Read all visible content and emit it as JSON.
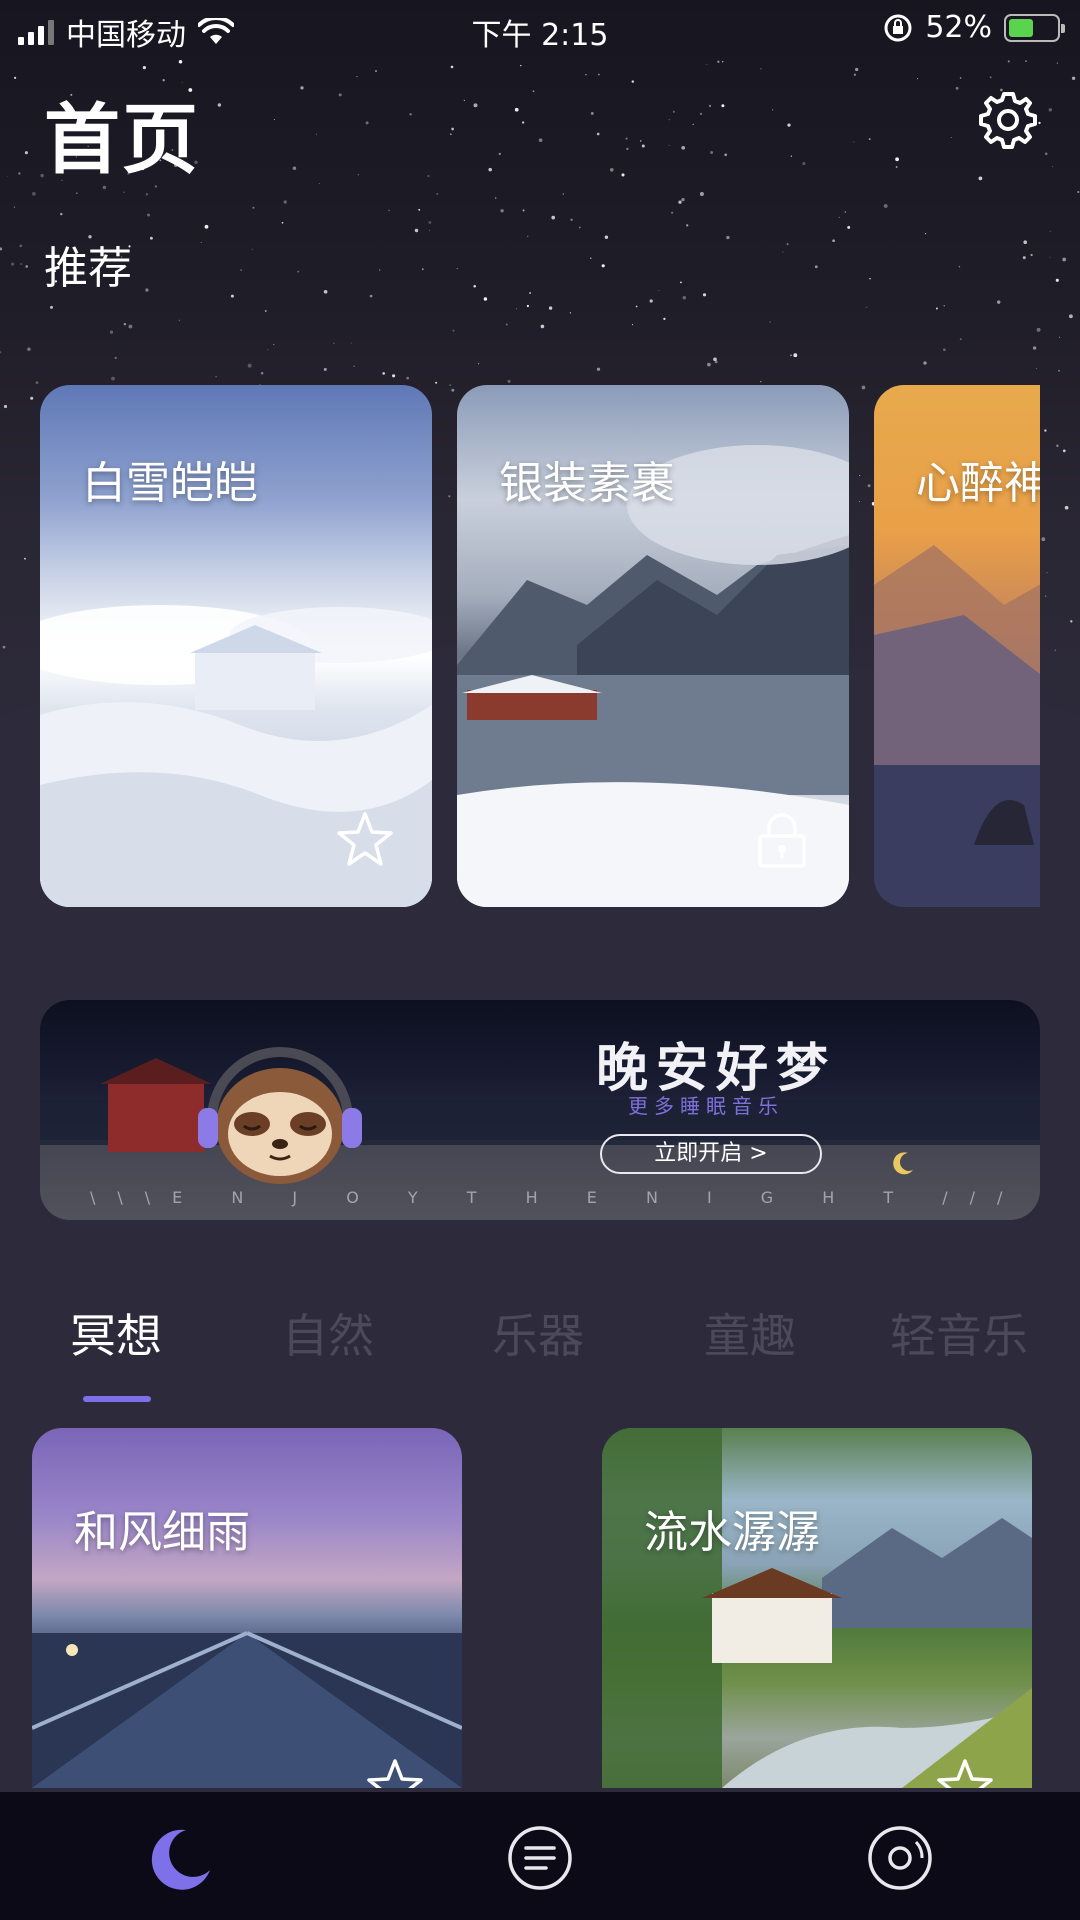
{
  "status_bar": {
    "carrier": "中国移动",
    "time": "下午 2:15",
    "battery_percent": "52%"
  },
  "header": {
    "title": "首页"
  },
  "recommend": {
    "section_title": "推荐",
    "cards": [
      {
        "label": "白雪皑皑",
        "icon": "star-outline-icon"
      },
      {
        "label": "银装素裹",
        "icon": "lock-icon"
      },
      {
        "label": "心醉神"
      }
    ]
  },
  "banner": {
    "title": "晚安好梦",
    "subtitle": "更多睡眠音乐",
    "button_label": "立即开启 >",
    "footer": "\\\\\\E N J O Y   T H E   N I G H T ///"
  },
  "categories": {
    "tabs": [
      "冥想",
      "自然",
      "乐器",
      "童趣",
      "轻音乐"
    ],
    "active_index": 0
  },
  "sounds": [
    {
      "label": "和风细雨",
      "icon": "star-outline-icon"
    },
    {
      "label": "流水潺潺",
      "icon": "star-outline-icon"
    }
  ],
  "tab_bar": {
    "items": [
      "moon-icon",
      "list-icon",
      "disc-icon"
    ],
    "active_index": 0
  },
  "colors": {
    "accent": "#7d70e8",
    "background": "#2d2a3b",
    "tab_bar": "#0b0a16",
    "inactive_tab_text": "#4c4959"
  }
}
